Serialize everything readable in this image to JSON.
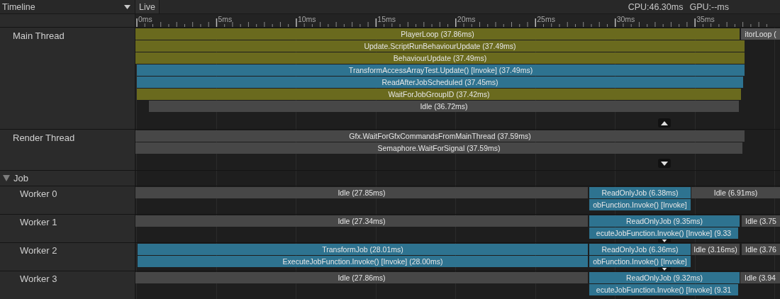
{
  "header": {
    "view_dropdown": "Timeline",
    "mode_tab": "Live",
    "cpu": "CPU:46.30ms",
    "gpu": "GPU:--ms"
  },
  "ruler": {
    "ticks": [
      "0ms",
      "5ms",
      "10ms",
      "15ms",
      "20ms",
      "25ms",
      "30ms",
      "35ms"
    ]
  },
  "tracks": [
    {
      "kind": "thread",
      "name": "Main Thread",
      "slices": [
        {
          "label": "PlayerLoop (37.86ms)",
          "kind": "script",
          "children": [
            {
              "label": "Update.ScriptRunBehaviourUpdate (37.49ms)",
              "kind": "script",
              "children": [
                {
                  "label": "BehaviourUpdate (37.49ms)",
                  "kind": "script",
                  "children": [
                    {
                      "label": "TransformAccessArrayTest.Update() [Invoke] (37.49ms)",
                      "kind": "job",
                      "children": [
                        {
                          "label": "ReadAfterJobScheduled (37.45ms)",
                          "kind": "job",
                          "children": [
                            {
                              "label": "WaitForJobGroupID (37.42ms)",
                              "kind": "script",
                              "children": [
                                {
                                  "label": "Idle (36.72ms)",
                                  "kind": "idle"
                                }
                              ]
                            }
                          ]
                        }
                      ]
                    }
                  ]
                }
              ]
            }
          ]
        },
        {
          "label": "itorLoop (",
          "kind": "other"
        }
      ]
    },
    {
      "kind": "thread",
      "name": "Render Thread",
      "slices": [
        {
          "label": "Gfx.WaitForGfxCommandsFromMainThread (37.59ms)",
          "kind": "idle",
          "children": [
            {
              "label": "Semaphore.WaitForSignal (37.59ms)",
              "kind": "idle"
            }
          ]
        }
      ]
    },
    {
      "kind": "group",
      "name": "Job",
      "expanded": true
    },
    {
      "kind": "worker",
      "name": "Worker 0",
      "slices": [
        {
          "label": "Idle (27.85ms)",
          "kind": "idle"
        },
        {
          "label": "ReadOnlyJob (6.38ms)",
          "kind": "job",
          "children": [
            {
              "label": "obFunction.Invoke() [Invoke]",
              "kind": "job"
            }
          ]
        },
        {
          "label": "Idle (6.91ms)",
          "kind": "idle"
        }
      ]
    },
    {
      "kind": "worker",
      "name": "Worker 1",
      "slices": [
        {
          "label": "Idle (27.34ms)",
          "kind": "idle"
        },
        {
          "label": "ReadOnlyJob (9.35ms)",
          "kind": "job",
          "children": [
            {
              "label": "ecuteJobFunction.Invoke() [Invoke] (9.33",
              "kind": "job"
            }
          ]
        },
        {
          "label": "Idle (3.75",
          "kind": "idle"
        }
      ]
    },
    {
      "kind": "worker",
      "name": "Worker 2",
      "slices": [
        {
          "label": "TransformJob (28.01ms)",
          "kind": "job",
          "children": [
            {
              "label": "ExecuteJobFunction.Invoke() [Invoke] (28.00ms)",
              "kind": "job"
            }
          ]
        },
        {
          "label": "ReadOnlyJob (6.36ms)",
          "kind": "job",
          "children": [
            {
              "label": "obFunction.Invoke() [Invoke]",
              "kind": "job"
            }
          ]
        },
        {
          "label": "Idle (3.16ms)",
          "kind": "idle"
        },
        {
          "label": "Idle (3.76",
          "kind": "idle"
        }
      ]
    },
    {
      "kind": "worker",
      "name": "Worker 3",
      "slices": [
        {
          "label": "Idle (27.86ms)",
          "kind": "idle"
        },
        {
          "label": "ReadOnlyJob (9.32ms)",
          "kind": "job",
          "children": [
            {
              "label": "ecuteJobFunction.Invoke() [Invoke] (9.31",
              "kind": "job"
            }
          ]
        },
        {
          "label": "Idle (3.94",
          "kind": "idle"
        }
      ]
    }
  ]
}
